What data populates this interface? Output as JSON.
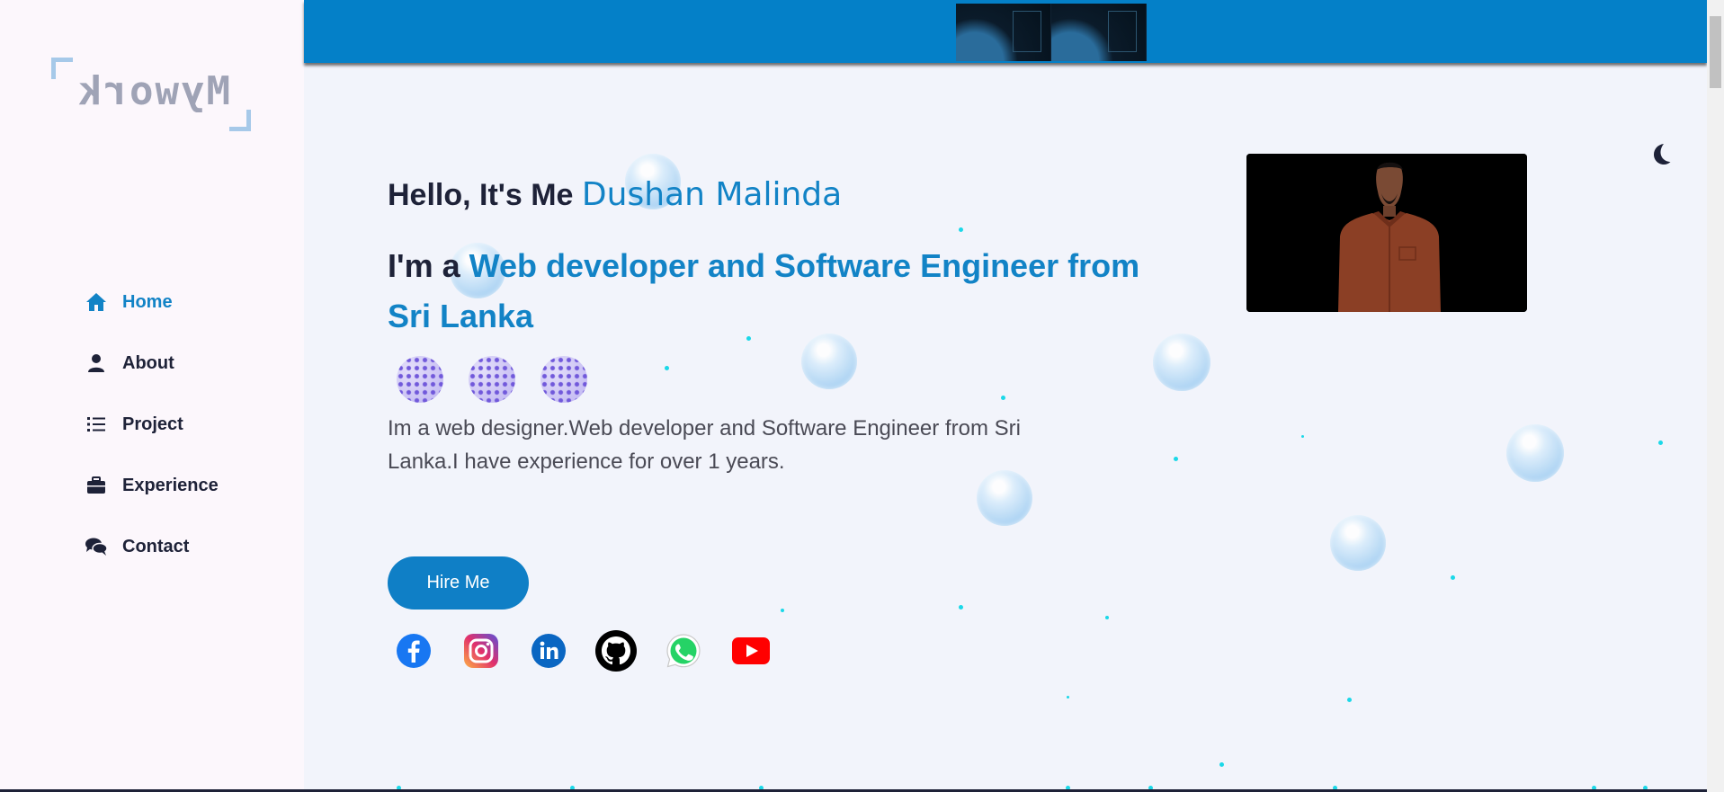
{
  "logo": {
    "text": "Mywork"
  },
  "nav": {
    "items": [
      {
        "label": "Home",
        "icon": "home-icon",
        "active": true
      },
      {
        "label": "About",
        "icon": "user-icon",
        "active": false
      },
      {
        "label": "Project",
        "icon": "list-icon",
        "active": false
      },
      {
        "label": "Experience",
        "icon": "briefcase-icon",
        "active": false
      },
      {
        "label": "Contact",
        "icon": "chat-icon",
        "active": false
      }
    ]
  },
  "hero": {
    "greeting_prefix": "Hello, It's Me",
    "name": "Dushan Malinda",
    "role_prefix": "I'm a",
    "role_highlight": "Web developer and Software Engineer from Sri Lanka",
    "description": "Im a web designer.Web developer and Software Engineer from Sri Lanka.I have experience for over 1 years.",
    "hire_button": "Hire Me"
  },
  "socials": [
    "facebook-icon",
    "instagram-icon",
    "linkedin-icon",
    "github-icon",
    "whatsapp-icon",
    "youtube-icon"
  ],
  "colors": {
    "accent": "#1283c6",
    "topbar": "#0480c8",
    "sidebar_bg": "#fcf7fc",
    "main_bg": "#f2f4fb",
    "particle": "#1bd8e8"
  }
}
